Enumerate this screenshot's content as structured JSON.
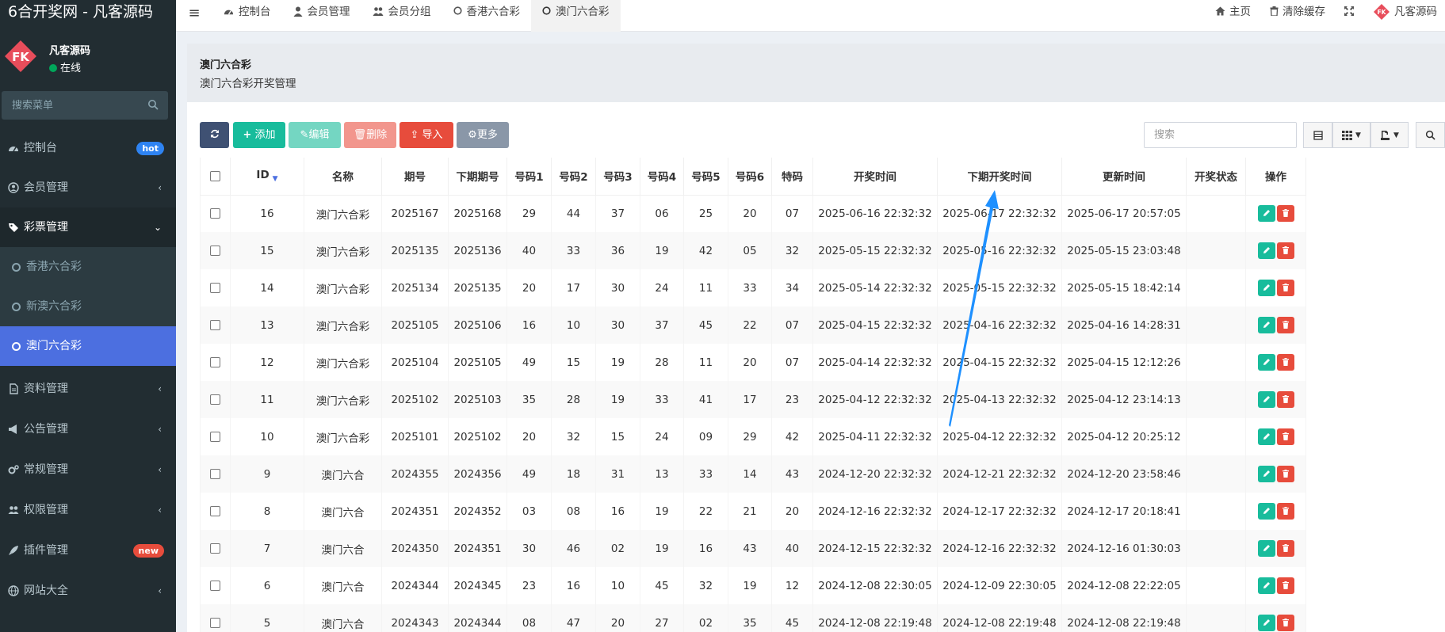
{
  "brand": "6合开奖网 - 凡客源码",
  "user": {
    "name": "凡客源码",
    "status": "在线"
  },
  "sidebar": {
    "search_placeholder": "搜索菜单",
    "items": [
      {
        "label": "控制台",
        "icon": "dashboard-icon",
        "badge": "hot",
        "badge_color": "#2e83f2"
      },
      {
        "label": "会员管理",
        "icon": "user-circle-icon"
      },
      {
        "label": "彩票管理",
        "icon": "tag-icon",
        "open": true
      },
      {
        "label": "资料管理",
        "icon": "file-icon"
      },
      {
        "label": "公告管理",
        "icon": "bullhorn-icon"
      },
      {
        "label": "常规管理",
        "icon": "cogs-icon"
      },
      {
        "label": "权限管理",
        "icon": "group-icon"
      },
      {
        "label": "插件管理",
        "icon": "rocket-icon",
        "badge": "new",
        "badge_color": "#e74c3c"
      },
      {
        "label": "网站大全",
        "icon": "globe-icon"
      }
    ],
    "subitems": [
      {
        "label": "香港六合彩"
      },
      {
        "label": "新澳六合彩"
      },
      {
        "label": "澳门六合彩",
        "active": true
      }
    ]
  },
  "topbar": {
    "tabs": [
      {
        "label": "控制台",
        "icon": "dashboard-icon"
      },
      {
        "label": "会员管理",
        "icon": "user-icon"
      },
      {
        "label": "会员分组",
        "icon": "users-icon"
      },
      {
        "label": "香港六合彩",
        "icon": "circle-icon"
      },
      {
        "label": "澳门六合彩",
        "icon": "circle-icon",
        "active": true
      }
    ],
    "right": [
      {
        "label": "主页",
        "icon": "home-icon"
      },
      {
        "label": "清除缓存",
        "icon": "trash-icon"
      },
      {
        "label": "",
        "icon": "fullscreen-icon"
      },
      {
        "label": "凡客源码",
        "icon": "avatar-icon"
      }
    ]
  },
  "page": {
    "title": "澳门六合彩",
    "subtitle": "澳门六合彩开奖管理"
  },
  "toolbar": {
    "refresh": "",
    "add": "添加",
    "edit": "编辑",
    "delete": "删除",
    "import": "导入",
    "more": "更多",
    "search_placeholder": "搜索"
  },
  "table": {
    "columns": [
      "ID",
      "名称",
      "期号",
      "下期期号",
      "号码1",
      "号码2",
      "号码3",
      "号码4",
      "号码5",
      "号码6",
      "特码",
      "开奖时间",
      "下期开奖时间",
      "更新时间",
      "开奖状态",
      "操作"
    ],
    "rows": [
      [
        "16",
        "澳门六合彩",
        "2025167",
        "2025168",
        "29",
        "44",
        "37",
        "06",
        "25",
        "20",
        "07",
        "2025-06-16 22:32:32",
        "2025-06-17 22:32:32",
        "2025-06-17 20:57:05",
        ""
      ],
      [
        "15",
        "澳门六合彩",
        "2025135",
        "2025136",
        "40",
        "33",
        "36",
        "19",
        "42",
        "05",
        "32",
        "2025-05-15 22:32:32",
        "2025-05-16 22:32:32",
        "2025-05-15 23:03:48",
        ""
      ],
      [
        "14",
        "澳门六合彩",
        "2025134",
        "2025135",
        "20",
        "17",
        "30",
        "24",
        "11",
        "33",
        "34",
        "2025-05-14 22:32:32",
        "2025-05-15 22:32:32",
        "2025-05-15 18:42:14",
        ""
      ],
      [
        "13",
        "澳门六合彩",
        "2025105",
        "2025106",
        "16",
        "10",
        "30",
        "37",
        "45",
        "22",
        "07",
        "2025-04-15 22:32:32",
        "2025-04-16 22:32:32",
        "2025-04-16 14:28:31",
        ""
      ],
      [
        "12",
        "澳门六合彩",
        "2025104",
        "2025105",
        "49",
        "15",
        "19",
        "28",
        "11",
        "20",
        "07",
        "2025-04-14 22:32:32",
        "2025-04-15 22:32:32",
        "2025-04-15 12:12:26",
        ""
      ],
      [
        "11",
        "澳门六合彩",
        "2025102",
        "2025103",
        "35",
        "28",
        "19",
        "33",
        "41",
        "17",
        "23",
        "2025-04-12 22:32:32",
        "2025-04-13 22:32:32",
        "2025-04-12 23:14:13",
        ""
      ],
      [
        "10",
        "澳门六合彩",
        "2025101",
        "2025102",
        "20",
        "32",
        "15",
        "24",
        "09",
        "29",
        "42",
        "2025-04-11 22:32:32",
        "2025-04-12 22:32:32",
        "2025-04-12 20:25:12",
        ""
      ],
      [
        "9",
        "澳门六合",
        "2024355",
        "2024356",
        "49",
        "18",
        "31",
        "13",
        "33",
        "14",
        "43",
        "2024-12-20 22:32:32",
        "2024-12-21 22:32:32",
        "2024-12-20 23:58:46",
        ""
      ],
      [
        "8",
        "澳门六合",
        "2024351",
        "2024352",
        "03",
        "08",
        "16",
        "19",
        "22",
        "21",
        "20",
        "2024-12-16 22:32:32",
        "2024-12-17 22:32:32",
        "2024-12-17 20:18:41",
        ""
      ],
      [
        "7",
        "澳门六合",
        "2024350",
        "2024351",
        "30",
        "46",
        "02",
        "19",
        "16",
        "43",
        "40",
        "2024-12-15 22:32:32",
        "2024-12-16 22:32:32",
        "2024-12-16 01:30:03",
        ""
      ],
      [
        "6",
        "澳门六合",
        "2024344",
        "2024345",
        "23",
        "16",
        "10",
        "45",
        "32",
        "19",
        "12",
        "2024-12-08 22:30:05",
        "2024-12-09 22:30:05",
        "2024-12-08 22:22:05",
        ""
      ],
      [
        "5",
        "澳门六合",
        "2024343",
        "2024344",
        "08",
        "47",
        "20",
        "27",
        "02",
        "35",
        "45",
        "2024-12-08 22:19:48",
        "2024-12-08 22:19:48",
        "2024-12-08 22:19:48",
        ""
      ]
    ]
  },
  "colors": {
    "sidebar_bg": "#222d32",
    "active_item": "#4c6fe0",
    "btn_refresh": "#3f5173",
    "btn_add": "#18bc9c",
    "btn_edit": "#74d6c2",
    "btn_delete": "#f2968d",
    "btn_import": "#e74c3c",
    "btn_more": "#8a97a8",
    "annotation_arrow": "#1e90ff"
  }
}
